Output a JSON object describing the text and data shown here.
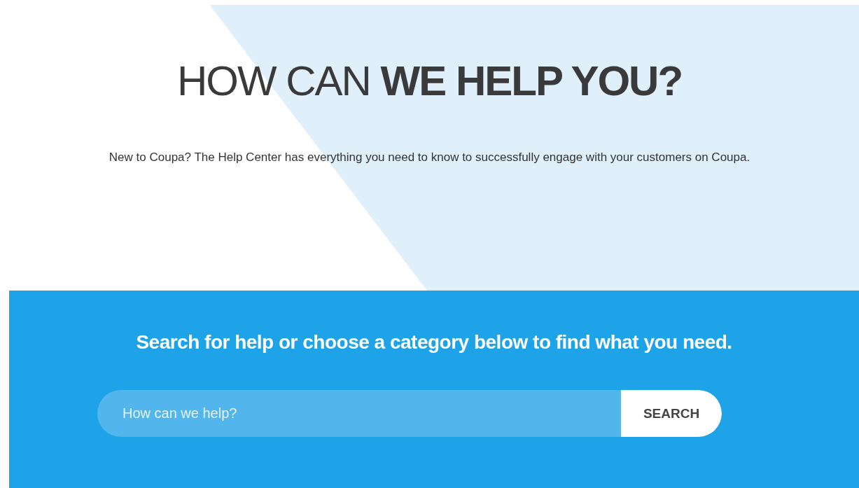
{
  "hero": {
    "title": "HOW CAN **WE HELP YOU?**",
    "description": "New to Coupa? The Help Center has everything you need to know to successfully engage with your customers on Coupa."
  },
  "search_section": {
    "heading": "Search for help or choose a category below to find what you need.",
    "search": {
      "placeholder": "How can we help?",
      "button": "SEARCH"
    }
  }
}
